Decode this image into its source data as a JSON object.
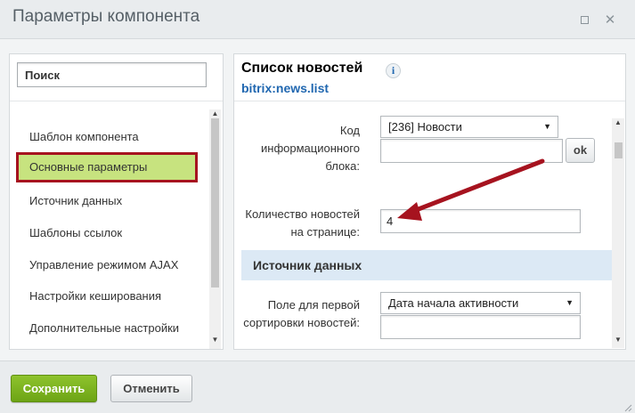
{
  "window": {
    "title": "Параметры компонента",
    "maximize_icon": "maximize-icon",
    "close_icon": "close-icon"
  },
  "sidebar": {
    "search_placeholder": "Поиск",
    "items": [
      {
        "label": "Шаблон компонента",
        "active": false
      },
      {
        "label": "Основные параметры",
        "active": true
      },
      {
        "label": "Источник данных",
        "active": false
      },
      {
        "label": "Шаблоны ссылок",
        "active": false
      },
      {
        "label": "Управление режимом AJAX",
        "active": false
      },
      {
        "label": "Настройки кеширования",
        "active": false
      },
      {
        "label": "Дополнительные настройки",
        "active": false
      }
    ]
  },
  "component": {
    "title": "Список новостей",
    "code": "bitrix:news.list",
    "info_icon": "i"
  },
  "fields": {
    "iblock": {
      "label": "Код информационного блока:",
      "selected": "[236] Новости",
      "input_value": "",
      "ok_label": "ok"
    },
    "news_count": {
      "label": "Количество новостей на странице:",
      "value": "4"
    },
    "section": "Источник данных",
    "sort1": {
      "label": "Поле для первой сортировки новостей:",
      "selected": "Дата начала активности",
      "input_value": ""
    }
  },
  "footer": {
    "save_label": "Сохранить",
    "cancel_label": "Отменить"
  },
  "colors": {
    "active_item_bg": "#c7e37f",
    "active_item_border": "#a6131f",
    "annotation_arrow": "#a6131f",
    "link_blue": "#2067b0",
    "save_button": "#7cb51f"
  }
}
